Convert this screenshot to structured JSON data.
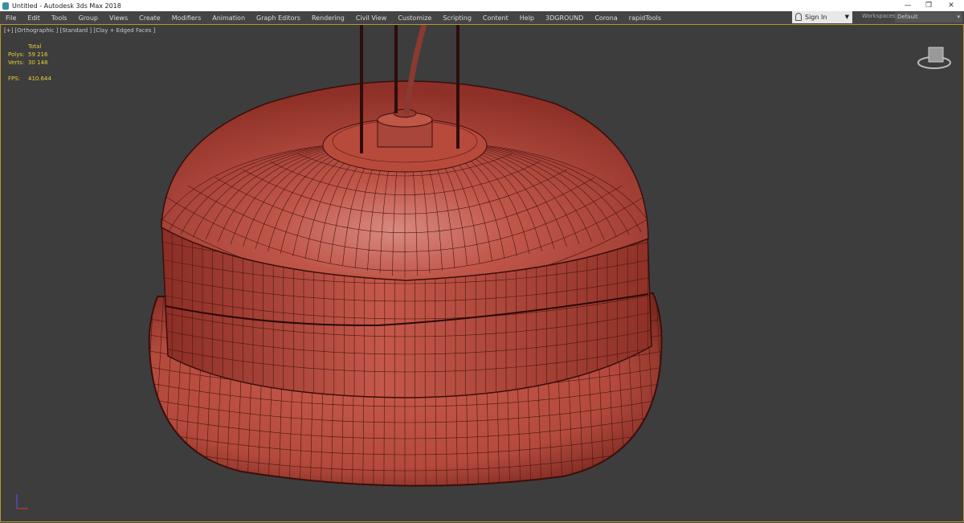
{
  "window": {
    "title": "Untitled - Autodesk 3ds Max 2018",
    "minimize": "—",
    "restore": "❐",
    "close": "✕"
  },
  "menu": [
    "File",
    "Edit",
    "Tools",
    "Group",
    "Views",
    "Create",
    "Modifiers",
    "Animation",
    "Graph Editors",
    "Rendering",
    "Civil View",
    "Customize",
    "Scripting",
    "Content",
    "Help",
    "3DGROUND",
    "Corona",
    "rapidTools"
  ],
  "signin": {
    "label": "Sign In",
    "icon": "user-icon"
  },
  "workspaces": {
    "label": "Workspaces:",
    "value": "Default"
  },
  "viewport": {
    "label": "[+] [Orthographic ] [Standard ] [Clay + Edged Faces ]",
    "stats": {
      "header": "Total",
      "polys_label": "Polys:",
      "polys": "59 216",
      "verts_label": "Verts:",
      "verts": "30 148",
      "fps_label": "FPS:",
      "fps": "410.644"
    },
    "object_color": "#b84a3c",
    "border_color": "#b8962e"
  }
}
